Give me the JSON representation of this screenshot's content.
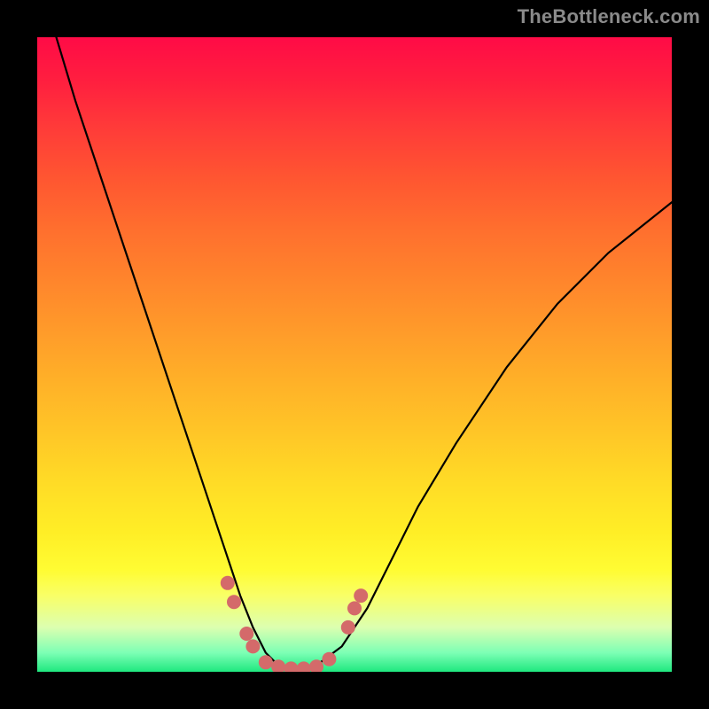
{
  "watermark": {
    "text": "TheBottleneck.com"
  },
  "chart_data": {
    "type": "line",
    "title": "",
    "xlabel": "",
    "ylabel": "",
    "xlim": [
      0,
      100
    ],
    "ylim": [
      0,
      100
    ],
    "grid": false,
    "legend": false,
    "series": [
      {
        "name": "bottleneck-curve",
        "x": [
          3,
          6,
          10,
          14,
          18,
          22,
          26,
          28,
          30,
          32,
          34,
          36,
          38,
          40,
          42,
          44,
          48,
          52,
          56,
          60,
          66,
          74,
          82,
          90,
          100
        ],
        "values": [
          100,
          90,
          78,
          66,
          54,
          42,
          30,
          24,
          18,
          12,
          7,
          3,
          1,
          0,
          0,
          1,
          4,
          10,
          18,
          26,
          36,
          48,
          58,
          66,
          74
        ]
      }
    ],
    "markers": {
      "name": "highlight-dots",
      "color": "#d46a6a",
      "points": [
        {
          "x": 30,
          "y": 14
        },
        {
          "x": 31,
          "y": 11
        },
        {
          "x": 33,
          "y": 6
        },
        {
          "x": 34,
          "y": 4
        },
        {
          "x": 36,
          "y": 1.5
        },
        {
          "x": 38,
          "y": 0.8
        },
        {
          "x": 40,
          "y": 0.5
        },
        {
          "x": 42,
          "y": 0.5
        },
        {
          "x": 44,
          "y": 0.8
        },
        {
          "x": 46,
          "y": 2
        },
        {
          "x": 49,
          "y": 7
        },
        {
          "x": 50,
          "y": 10
        },
        {
          "x": 51,
          "y": 12
        }
      ]
    },
    "background_gradient": {
      "top": "#ff0b46",
      "mid": "#ffee26",
      "bottom": "#1fe87f"
    }
  }
}
